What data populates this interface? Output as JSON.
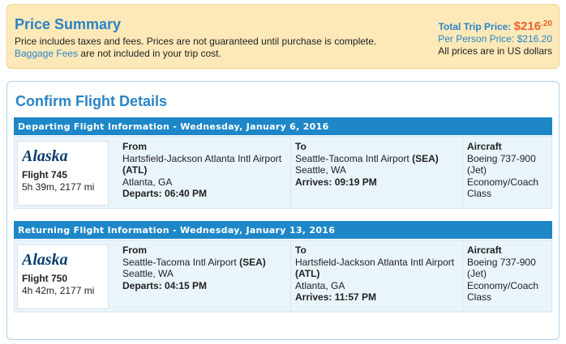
{
  "price_summary": {
    "title": "Price Summary",
    "line1": "Price includes taxes and fees. Prices are not guaranteed until purchase is complete.",
    "baggage_link": "Baggage Fees",
    "line2_rest": " are not included in your trip cost.",
    "total_label": "Total Trip Price:",
    "total_dollars": "$216",
    "total_cents": ".20",
    "per_person": "Per Person Price: $216.20",
    "currency_note": "All prices are in US dollars"
  },
  "confirm": {
    "title": "Confirm Flight Details",
    "departing": {
      "header": "Departing Flight Information - Wednesday, January 6, 2016",
      "airline": "Alaska",
      "flight": "Flight 745",
      "meta": "5h 39m, 2177 mi",
      "from_label": "From",
      "from_airport": "Hartsfield-Jackson Atlanta Intl Airport",
      "from_code": "(ATL)",
      "from_city": "Atlanta, GA",
      "departs": "Departs: 06:40 PM",
      "to_label": "To",
      "to_airport": "Seattle-Tacoma Intl Airport",
      "to_code": "(SEA)",
      "to_city": "Seattle, WA",
      "arrives": "Arrives: 09:19 PM",
      "aircraft_label": "Aircraft",
      "aircraft_model": "Boeing 737-900",
      "aircraft_type": "(Jet)",
      "cabin": "Economy/Coach",
      "cabin2": "Class"
    },
    "returning": {
      "header": "Returning Flight Information - Wednesday, January 13, 2016",
      "airline": "Alaska",
      "flight": "Flight 750",
      "meta": "4h 42m, 2177 mi",
      "from_label": "From",
      "from_airport": "Seattle-Tacoma Intl Airport",
      "from_code": "(SEA)",
      "from_city": "Seattle, WA",
      "departs": "Departs: 04:15 PM",
      "to_label": "To",
      "to_airport": "Hartsfield-Jackson Atlanta Intl Airport",
      "to_code": "(ATL)",
      "to_city": "Atlanta, GA",
      "arrives": "Arrives: 11:57 PM",
      "aircraft_label": "Aircraft",
      "aircraft_model": "Boeing 737-900",
      "aircraft_type": "(Jet)",
      "cabin": "Economy/Coach",
      "cabin2": "Class"
    }
  },
  "colors": {
    "accent": "#2a84c6",
    "price": "#e8612c",
    "bar": "#1e87c8",
    "summary_bg": "#fde9b8",
    "logo": "#0b3f6e"
  }
}
